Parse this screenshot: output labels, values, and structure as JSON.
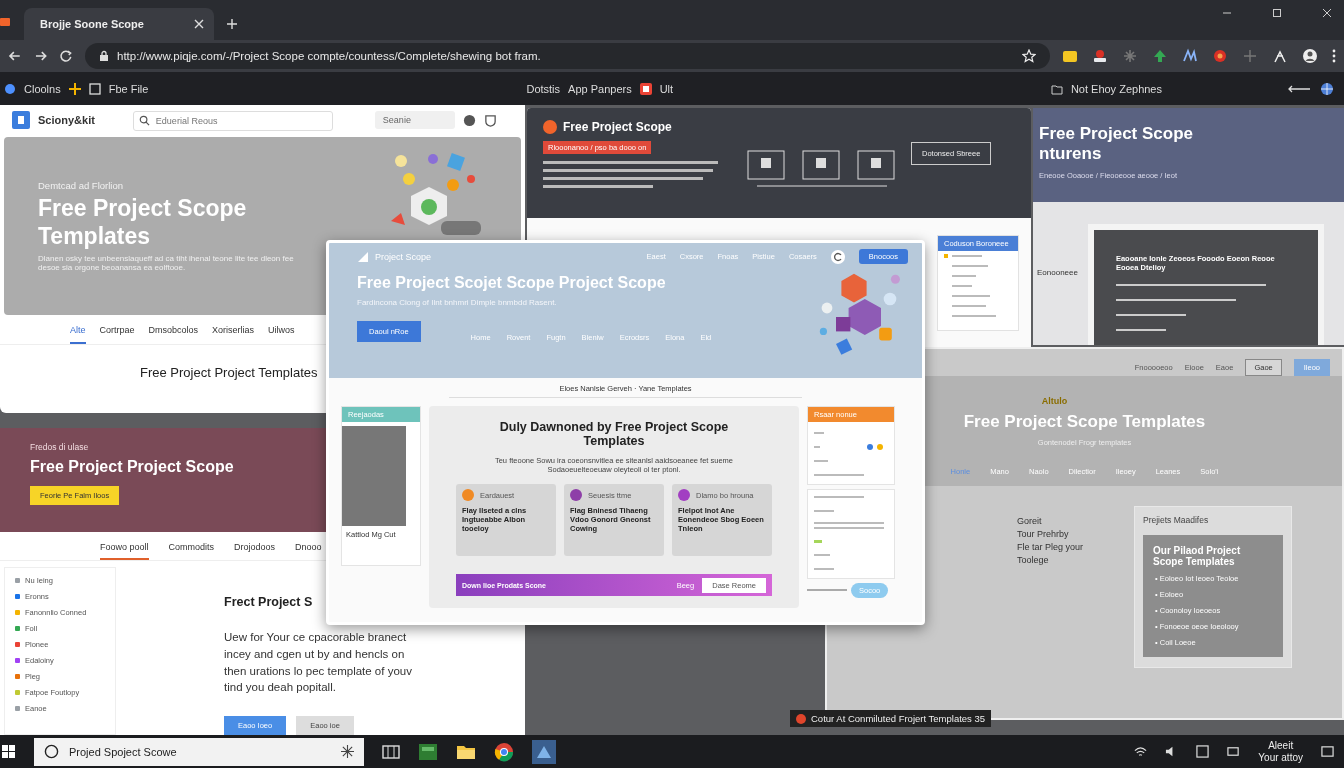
{
  "browser": {
    "tab_title": "Brojje Soone Scope",
    "url": "http://www.piqje.com/-/Project Scope compte/countess/Complete/shewing bot fram.",
    "bookmarks_left": [
      "Cloolns",
      "Fbe File"
    ],
    "bookmarks_mid": [
      "Dotstis",
      "App Panpers",
      "Ult"
    ],
    "bookmark_right": "Not Ehoy Zephnes"
  },
  "win_a": {
    "logo": "Sciony&kit",
    "search_placeholder": "Eduerial Reous",
    "select": "Seanie",
    "eyebrow": "Demtcad ad Florlion",
    "title": "Free Project Scope Templates",
    "desc": "Dlanen osky tee unbeenslaqueff ad ca tiht ihenal teone lite tee dleon fee desoe sia orgone beoanansa ea eolftooe.",
    "heading": "Free Project Project Templates",
    "tabs": [
      {
        "label": "Alte",
        "selected": true
      },
      {
        "label": "Cortrpae",
        "selected": false
      },
      {
        "label": "Dmsobcolos",
        "selected": false
      },
      {
        "label": "Xoriserlias",
        "selected": false
      },
      {
        "label": "Uilwos",
        "selected": false
      }
    ]
  },
  "win_b": {
    "title": "Free Project Scope",
    "tag": "Rlooonanoo / pso ba dooo on",
    "panel": "Dotonsed Sbreee",
    "list_title": "Coduson Boroneee"
  },
  "win_c": {
    "title": "Free Project Scope",
    "title2": "nturens",
    "subtitle": "Eneooe Ooaooe / Fieooeooe aeooe / Ieot",
    "side": "Eonooneee",
    "inner_heading": "Eaooane Ionle Zeoeos Fooodo Eoeon Reooe Eooea Dtelioy"
  },
  "win_d": {
    "eyebrow": "Fredos di ulase",
    "title": "Free Project Project Scope",
    "cta": "Feorie Pe Falm Iloos",
    "tabs": [
      {
        "label": "Foowo pooll",
        "selected": true
      },
      {
        "label": "Commodits",
        "selected": false
      },
      {
        "label": "Drojodoos",
        "selected": false
      },
      {
        "label": "Dnooo",
        "selected": false
      }
    ],
    "sidebar": [
      {
        "label": "Nu Ieing",
        "color": "#9aa0a6"
      },
      {
        "label": "Eronns",
        "color": "#1a73e8"
      },
      {
        "label": "Fanonnlio Conned",
        "color": "#f4b400"
      },
      {
        "label": "Foll",
        "color": "#34a853"
      },
      {
        "label": "Plonee",
        "color": "#ea4335"
      },
      {
        "label": "Edaloiny",
        "color": "#a142f4"
      },
      {
        "label": "Pleg",
        "color": "#e8710a"
      },
      {
        "label": "Fatpoe Foutlopy",
        "color": "#c0ca33"
      },
      {
        "label": "Eanoe",
        "color": "#9aa0a6"
      }
    ],
    "heading": "Frect Project S",
    "paragraph": "Uew for Your ce cpacorable branect incey and cgen ut by and hencls on then urations lo pec template of youv tind you deah popitall.",
    "buttons": [
      "Eaoo Ioeo",
      "Eaoo ioe"
    ]
  },
  "win_e": {
    "top_links": [
      "Fnooooeoo",
      "Eiooe",
      "Eaoe"
    ],
    "buttons": [
      "Gaoe",
      "Ileoo"
    ],
    "eyebrow": "Altulo",
    "title": "Free Project Scope Templates",
    "subtitle": "Gontenodel Frogr templates",
    "nav": [
      {
        "label": "Honle",
        "selected": true
      },
      {
        "label": "Mano",
        "selected": false
      },
      {
        "label": "Naolo",
        "selected": false
      },
      {
        "label": "Dilectior",
        "selected": false
      },
      {
        "label": "Ileoey",
        "selected": false
      },
      {
        "label": "Leanes",
        "selected": false
      },
      {
        "label": "Solo'i",
        "selected": false
      }
    ],
    "lines": [
      "Goreit",
      "Tour Prehrby",
      "Fle tar Pleg your",
      "Toolege"
    ],
    "panel_title": "Prejiets Maadifes",
    "card_title": "Our Pilaod Project Scope Templates",
    "bullets": [
      "• Eoloeo Iot Ieoeo Teoloe",
      "• Eoloeo",
      "• Coonoloy Ioeoeos",
      "• Fonoeoe oeoe Ioeolooy",
      "• Coil Loeoe"
    ]
  },
  "win_f": {
    "logo": "Project Scope",
    "nav": [
      "Eaest",
      "Cxsore",
      "Fnoas",
      "Pistiue",
      "Cosaers"
    ],
    "signin": "Bnocoos",
    "title": "Free Project Scojet Scope Project Scope",
    "subtitle": "Fardincona Ciong of Ilnt bnhmri Dimple bnmbdd Rasent.",
    "cta": "Daoul nRoe",
    "menu": [
      "Home",
      "Rovent",
      "Fugtn",
      "Bleniw",
      "Ecrodsrs",
      "Elona",
      "Eld"
    ],
    "breadcrumb": "Eloes Nanlsie Gerveh · Yane Templates",
    "left_widget": {
      "header": "Reejaodas",
      "caption": "Kattlod Mg Cut"
    },
    "main": {
      "title": "Duly Dawnoned by Free Project Scope Templates",
      "desc": "Teu fteoone Sowu ira coeonsnvitlea ee siteanlsl aaidsoeanee fet sueme Sodaoeuelteoeuaw oleyteoli ol ter ptonl.",
      "cards": [
        {
          "label": "Eardauest",
          "body": "Flay Ilseted a clns Ingtueabbe Albon tooeloy",
          "color": "#f08a24"
        },
        {
          "label": "Seuesis ttme",
          "body": "Flag Bninesd Tihaeng Vdoo Gonord Gneonst Cowing",
          "color": "#8e3fa8"
        },
        {
          "label": "Dlamo bo hrouna",
          "body": "Flelpot Inot Ane Eonendeoe Sbog Eoeen Tnleon",
          "color": "#a23fc2"
        }
      ],
      "banner": "Down lioe Prodats Scone",
      "banner_link": "Beeg",
      "banner_button": "Dase Reome"
    },
    "right_widget": {
      "header": "Rsaar nonue",
      "chat": "Socoo"
    }
  },
  "toast": "Cotur At Conmiluted Frojert Templates 35",
  "taskbar": {
    "search": "Projed Spoject Scowe",
    "clock_top": "Aleeit",
    "clock_bottom": "Your attoy"
  }
}
